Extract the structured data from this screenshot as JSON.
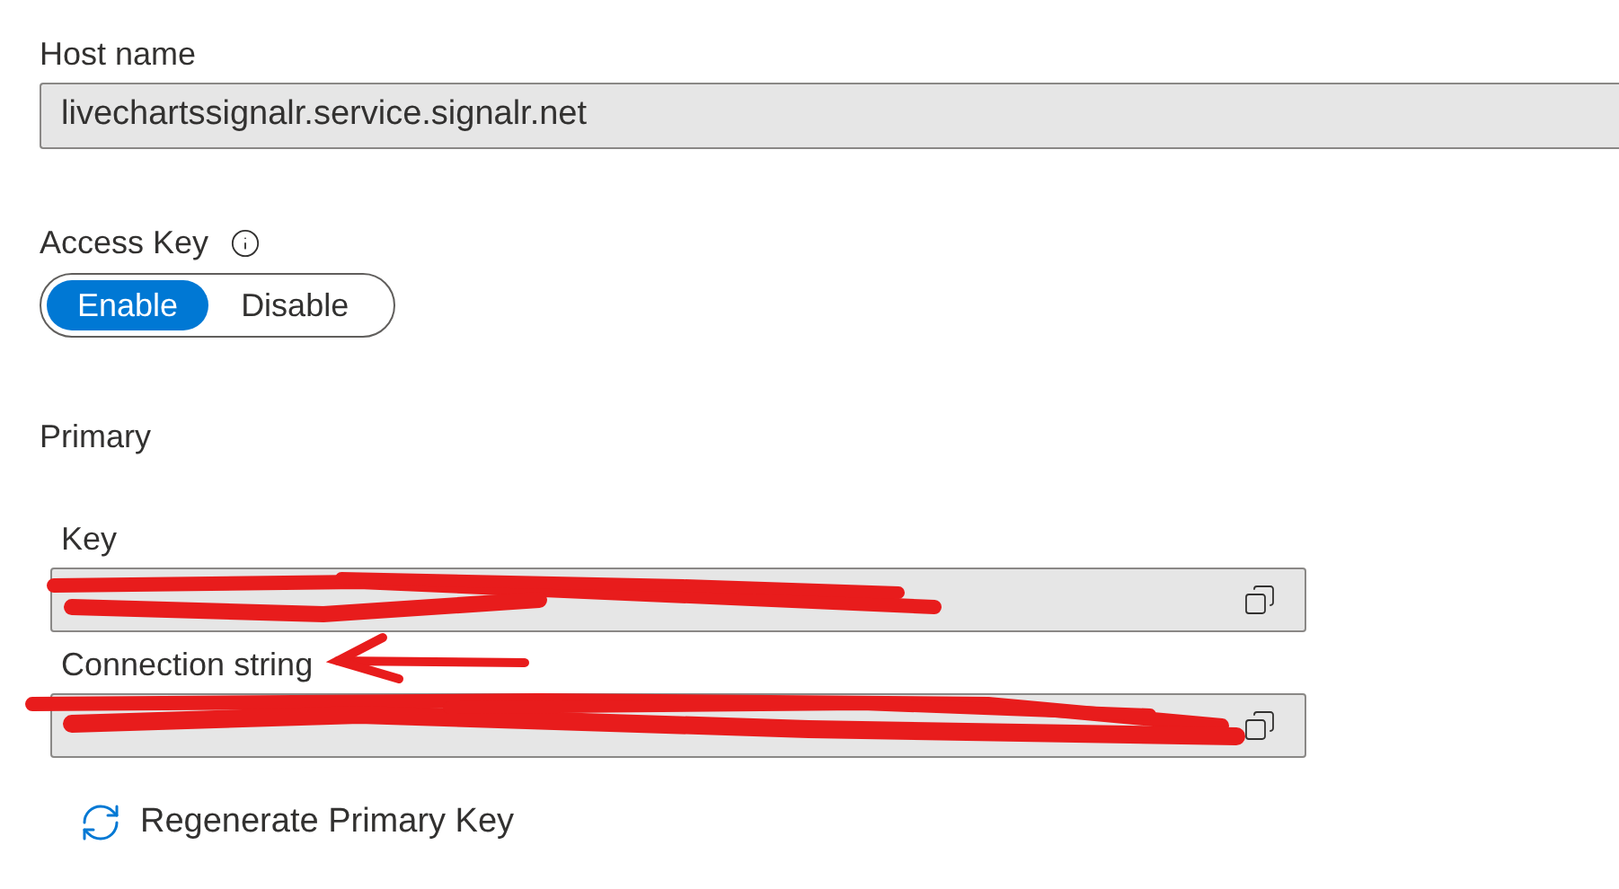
{
  "host_name": {
    "label": "Host name",
    "value": "livechartssignalr.service.signalr.net"
  },
  "access_key": {
    "label": "Access Key",
    "options": [
      {
        "label": "Enable",
        "selected": true
      },
      {
        "label": "Disable",
        "selected": false
      }
    ]
  },
  "primary": {
    "title": "Primary",
    "fields": [
      {
        "label": "Key"
      },
      {
        "label": "Connection string"
      }
    ]
  },
  "regenerate_button": {
    "label": "Regenerate Primary Key"
  }
}
